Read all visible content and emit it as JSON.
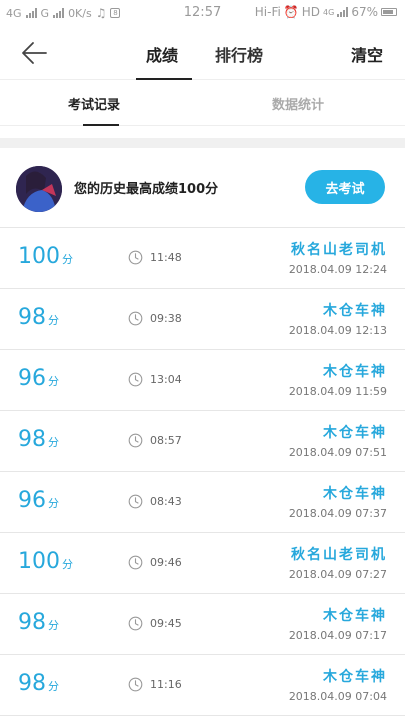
{
  "status_bar": {
    "left_net1": "4G",
    "left_net2": "G",
    "speed": "0K/s",
    "time": "12:57",
    "wifi": "Hi-Fi",
    "hd": "HD",
    "net4g": "4G",
    "battery": "67%"
  },
  "nav": {
    "tabs": [
      "成绩",
      "排行榜"
    ],
    "clear_label": "清空"
  },
  "sub_tabs": [
    "考试记录",
    "数据统计"
  ],
  "best": {
    "text": "您的历史最高成绩100分",
    "button_label": "去考试"
  },
  "colors": {
    "accent": "#27a8dc",
    "button": "#27b3e6"
  },
  "records": [
    {
      "score": "100",
      "unit": "分",
      "duration": "11:48",
      "title": "秋名山老司机",
      "date": "2018.04.09  12:24"
    },
    {
      "score": "98",
      "unit": "分",
      "duration": "09:38",
      "title": "木仓车神",
      "date": "2018.04.09  12:13"
    },
    {
      "score": "96",
      "unit": "分",
      "duration": "13:04",
      "title": "木仓车神",
      "date": "2018.04.09  11:59"
    },
    {
      "score": "98",
      "unit": "分",
      "duration": "08:57",
      "title": "木仓车神",
      "date": "2018.04.09  07:51"
    },
    {
      "score": "96",
      "unit": "分",
      "duration": "08:43",
      "title": "木仓车神",
      "date": "2018.04.09  07:37"
    },
    {
      "score": "100",
      "unit": "分",
      "duration": "09:46",
      "title": "秋名山老司机",
      "date": "2018.04.09  07:27"
    },
    {
      "score": "98",
      "unit": "分",
      "duration": "09:45",
      "title": "木仓车神",
      "date": "2018.04.09  07:17"
    },
    {
      "score": "98",
      "unit": "分",
      "duration": "11:16",
      "title": "木仓车神",
      "date": "2018.04.09  07:04"
    }
  ]
}
